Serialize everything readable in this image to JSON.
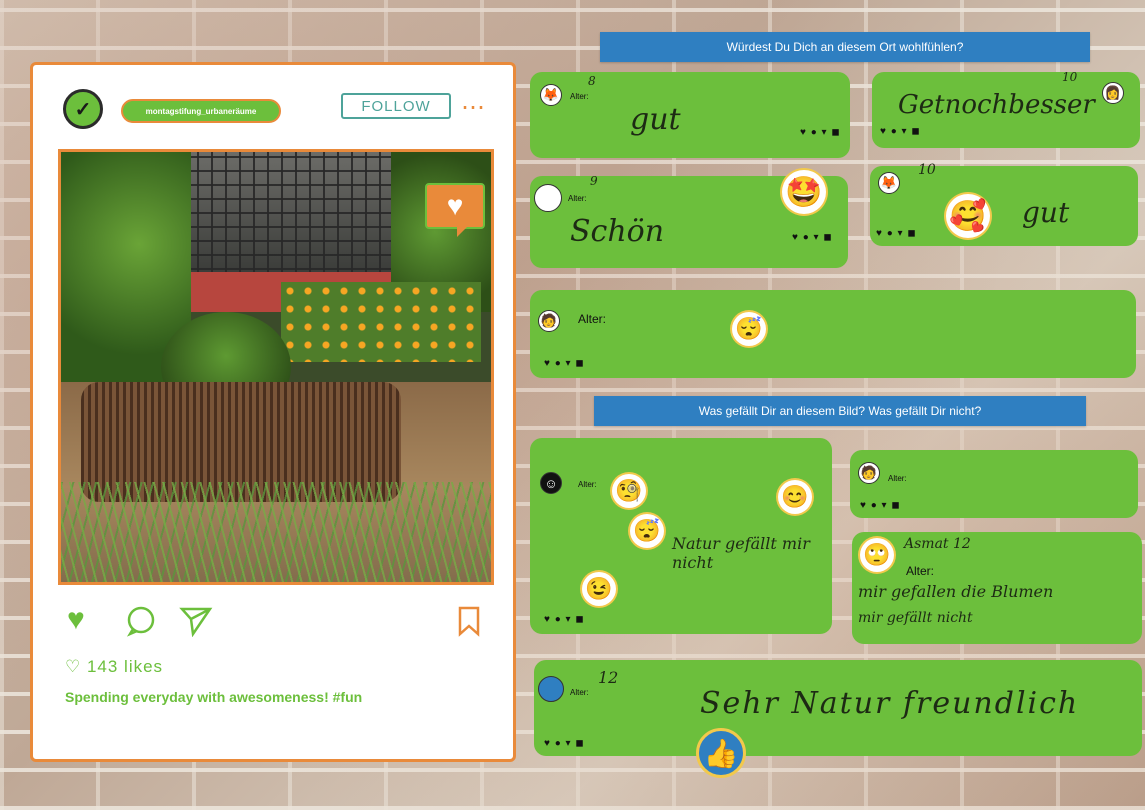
{
  "post": {
    "handle": "montagstifung_urbaneräume",
    "follow_label": "FOLLOW",
    "more_icon": "⋯",
    "likes": "♡ 143 likes",
    "caption": "Spending everyday with awesomeness! #fun"
  },
  "banners": {
    "q1": "Würdest Du Dich an diesem Ort wohlfühlen?",
    "q2": "Was gefällt Dir an diesem Bild? Was gefällt Dir nicht?"
  },
  "comments": {
    "c1": {
      "age_label": "Alter:",
      "age_value": "8",
      "text": "gut"
    },
    "c2": {
      "age_value": "10",
      "text": "Getnochbesser"
    },
    "c3": {
      "age_label": "Alter:",
      "age_value": "9",
      "text": "Schön"
    },
    "c4": {
      "age_value": "10",
      "text": "gut"
    },
    "c5": {
      "age_label": "Alter:"
    },
    "c6": {
      "age_label": "Alter:",
      "text": "Natur gefällt mir nicht"
    },
    "c7": {
      "age_label": "Alter:"
    },
    "c8": {
      "name": "Asmat 12",
      "age_label": "Alter:",
      "text1": "mir gefallen die Blumen",
      "text2": "mir gefällt nicht"
    },
    "c9": {
      "age_label": "Alter:",
      "age_value": "12",
      "text": "Sehr Natur freundlich"
    }
  },
  "icons": {
    "dots": "♥ ● ▾ ◼"
  },
  "colors": {
    "accent_orange": "#e98a3a",
    "accent_green": "#6cbf3c",
    "banner_blue": "#2f7fc1"
  }
}
